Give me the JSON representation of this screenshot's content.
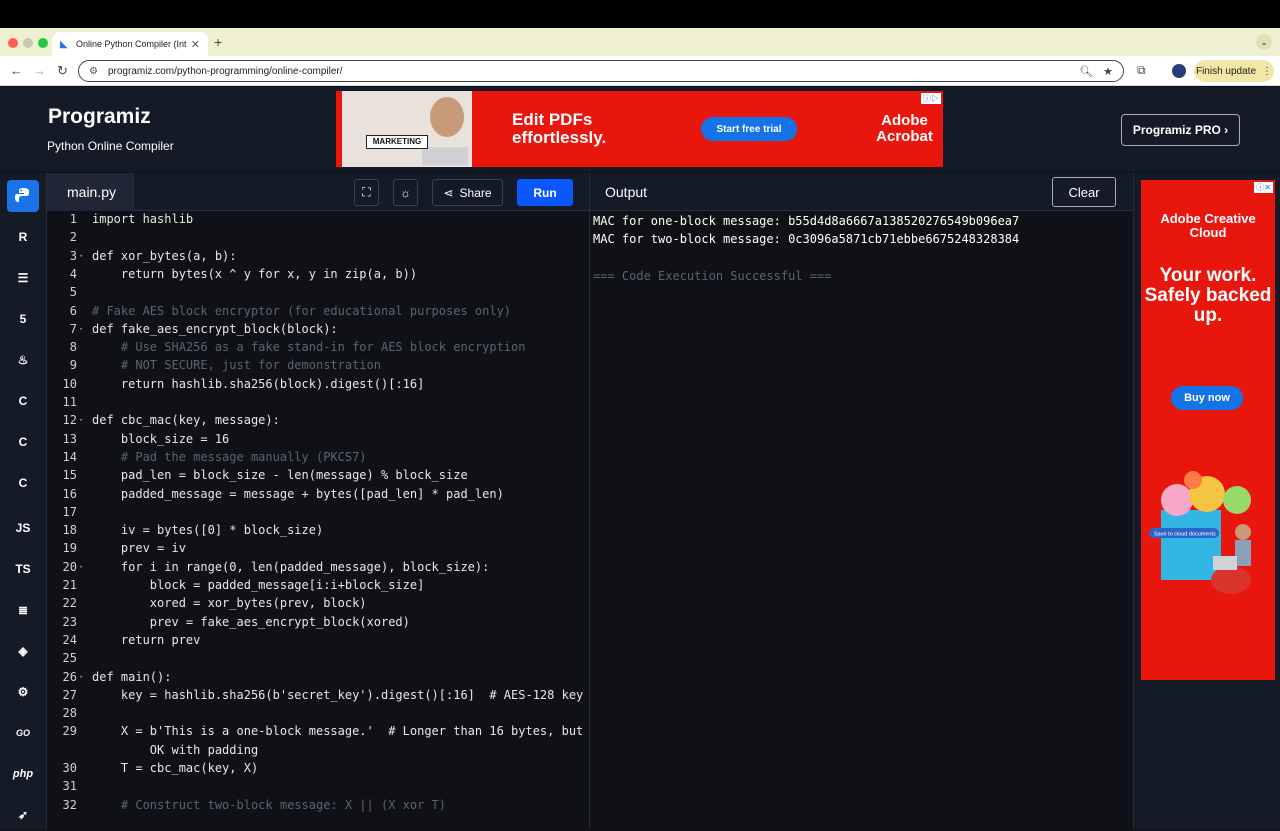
{
  "browser": {
    "tab_title": "Online Python Compiler (Inte",
    "url": "programiz.com/python-programming/online-compiler/",
    "finish_update": "Finish update"
  },
  "header": {
    "logo": "Programiz",
    "subtitle": "Python Online Compiler",
    "pro_button": "Programiz PRO ›"
  },
  "banner_ad": {
    "label": "MARKETING",
    "headline": "Edit PDFs effortlessly.",
    "cta": "Start free trial",
    "brand": "Adobe Acrobat"
  },
  "sidebar": {
    "languages": [
      "python-icon",
      "r-icon",
      "sql-icon",
      "html5-icon",
      "java-icon",
      "c-icon",
      "cpp-icon",
      "csharp-icon",
      "JS",
      "TS",
      "go-icon",
      "kotlin-icon",
      "rust-icon",
      "GO",
      "php",
      "swift-icon"
    ]
  },
  "editor": {
    "filename": "main.py",
    "share_label": "Share",
    "run_label": "Run",
    "lines": [
      {
        "n": "1",
        "t": "import hashlib"
      },
      {
        "n": "2",
        "t": ""
      },
      {
        "n": "3",
        "t": "def xor_bytes(a, b):"
      },
      {
        "n": "4",
        "t": "    return bytes(x ^ y for x, y in zip(a, b))"
      },
      {
        "n": "5",
        "t": ""
      },
      {
        "n": "6",
        "t": "# Fake AES block encryptor (for educational purposes only)"
      },
      {
        "n": "7",
        "t": "def fake_aes_encrypt_block(block):"
      },
      {
        "n": "8",
        "t": "    # Use SHA256 as a fake stand-in for AES block encryption"
      },
      {
        "n": "9",
        "t": "    # NOT SECURE, just for demonstration"
      },
      {
        "n": "10",
        "t": "    return hashlib.sha256(block).digest()[:16]"
      },
      {
        "n": "11",
        "t": ""
      },
      {
        "n": "12",
        "t": "def cbc_mac(key, message):"
      },
      {
        "n": "13",
        "t": "    block_size = 16"
      },
      {
        "n": "14",
        "t": "    # Pad the message manually (PKCS7)"
      },
      {
        "n": "15",
        "t": "    pad_len = block_size - len(message) % block_size"
      },
      {
        "n": "16",
        "t": "    padded_message = message + bytes([pad_len] * pad_len)"
      },
      {
        "n": "17",
        "t": ""
      },
      {
        "n": "18",
        "t": "    iv = bytes([0] * block_size)"
      },
      {
        "n": "19",
        "t": "    prev = iv"
      },
      {
        "n": "20",
        "t": "    for i in range(0, len(padded_message), block_size):"
      },
      {
        "n": "21",
        "t": "        block = padded_message[i:i+block_size]"
      },
      {
        "n": "22",
        "t": "        xored = xor_bytes(prev, block)"
      },
      {
        "n": "23",
        "t": "        prev = fake_aes_encrypt_block(xored)"
      },
      {
        "n": "24",
        "t": "    return prev"
      },
      {
        "n": "25",
        "t": ""
      },
      {
        "n": "26",
        "t": "def main():"
      },
      {
        "n": "27",
        "t": "    key = hashlib.sha256(b'secret_key').digest()[:16]  # AES-128 key"
      },
      {
        "n": "28",
        "t": ""
      },
      {
        "n": "29",
        "t": "    X = b'This is a one-block message.'  # Longer than 16 bytes, but"
      },
      {
        "n": "",
        "t": "        OK with padding"
      },
      {
        "n": "30",
        "t": "    T = cbc_mac(key, X)"
      },
      {
        "n": "31",
        "t": ""
      },
      {
        "n": "32",
        "t": "    # Construct two-block message: X || (X xor T)"
      }
    ]
  },
  "output": {
    "title": "Output",
    "clear_label": "Clear",
    "lines": [
      "MAC for one-block message: b55d4d8a6667a138520276549b096ea7",
      "MAC for two-block message: 0c3096a5871cb71ebbe6675248328384",
      "",
      "=== Code Execution Successful ==="
    ]
  },
  "side_ad": {
    "brand": "Adobe Creative Cloud",
    "headline": "Your work. Safely backed up.",
    "cta": "Buy now",
    "art_text": "Save to cloud documents"
  }
}
